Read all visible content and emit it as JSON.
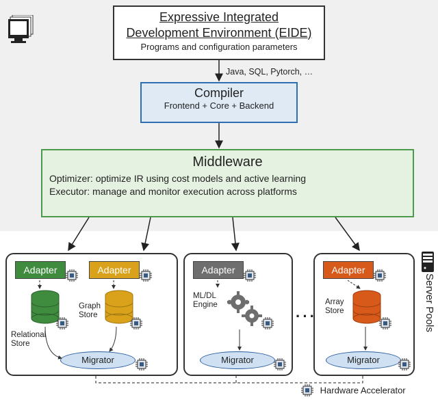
{
  "eide": {
    "title_line1": "Expressive Integrated",
    "title_line2": "Development Environment (EIDE)",
    "subtitle": "Programs and configuration parameters"
  },
  "languages_label": "Java, SQL, Pytorch, …",
  "compiler": {
    "title": "Compiler",
    "subtitle": "Frontend + Core + Backend"
  },
  "middleware": {
    "title": "Middleware",
    "optimizer_label": "Optimizer:",
    "optimizer_desc": "optimize IR using cost models and active learning",
    "executor_label": "Executor:",
    "executor_desc": "manage and monitor execution across platforms"
  },
  "adapter_label": "Adapter",
  "migrator_label": "Migrator",
  "engine1": {
    "store1_label": "Relational\nStore",
    "store2_label": "Graph\nStore"
  },
  "engine2": {
    "engine_label": "ML/DL\nEngine"
  },
  "engine3": {
    "store_label": "Array\nStore"
  },
  "ellipsis": "····",
  "server_pools_label": "Server Pools",
  "legend_label": "Hardware Accelerator",
  "colors": {
    "compiler_border": "#2b6fb0",
    "compiler_fill": "#dfeaf5",
    "middleware_border": "#4a9a4a",
    "middleware_fill": "#e6f2e1",
    "adapter_green": "#3f8c3f",
    "adapter_gold": "#d9a21a",
    "adapter_gray": "#6e6e6e",
    "adapter_orange": "#d85a1a",
    "migrator_border": "#2a5d9e",
    "migrator_fill": "#cfe0f2"
  }
}
